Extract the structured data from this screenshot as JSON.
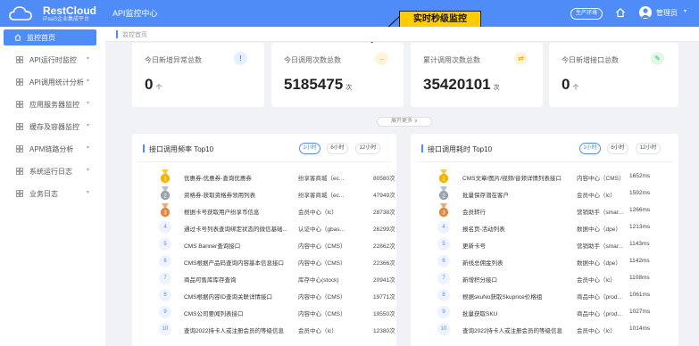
{
  "header": {
    "logo_name": "RestCloud",
    "logo_sub": "iPaaS企业集成平台",
    "app_title": "API监控中心",
    "env_button": "生产环境",
    "user_name": "管理员",
    "user_caret": "▾",
    "brand_color": "#4f8cf7"
  },
  "annotation": {
    "label": "实时秒级监控"
  },
  "sidebar": {
    "items": [
      {
        "label": "监控首页",
        "icon": "home-icon",
        "caret": ""
      },
      {
        "label": "API运行时监控",
        "icon": "grid-icon",
        "caret": "▾"
      },
      {
        "label": "API调用统计分析",
        "icon": "grid-icon",
        "caret": "▾"
      },
      {
        "label": "应用服务器监控",
        "icon": "grid-icon",
        "caret": "▾"
      },
      {
        "label": "缓存及容器监控",
        "icon": "grid-icon",
        "caret": "▾"
      },
      {
        "label": "APM链路分析",
        "icon": "grid-icon",
        "caret": "▾"
      },
      {
        "label": "系统运行日志",
        "icon": "grid-icon",
        "caret": "▾"
      },
      {
        "label": "业务日志",
        "icon": "grid-icon",
        "caret": "▾"
      }
    ]
  },
  "breadcrumb": {
    "current": "监控首页"
  },
  "stats": [
    {
      "title": "今日新增异常总数",
      "value": "0",
      "unit": "个",
      "badge": "!",
      "badge_bg": "#e6efff",
      "badge_color": "#4f8cf7"
    },
    {
      "title": "今日调用次数总数",
      "value": "5185475",
      "unit": "次",
      "badge": "→",
      "badge_bg": "#fff3dc",
      "badge_color": "#f5a623"
    },
    {
      "title": "累计调用次数总数",
      "value": "35420101",
      "unit": "次",
      "badge": "⇄",
      "badge_bg": "#fff3dc",
      "badge_color": "#f5a623"
    },
    {
      "title": "今日新增接口总数",
      "value": "0",
      "unit": "个",
      "badge": "✎",
      "badge_bg": "#e3f7e8",
      "badge_color": "#2eb85c"
    }
  ],
  "expand_more": "展开更多 ∨",
  "panels": [
    {
      "title": "接口调用频率 Top10",
      "tabs": [
        "1小时",
        "6小时",
        "12小时"
      ],
      "active_tab": 0,
      "rows": [
        {
          "rank": "1",
          "name": "优惠券-优惠券-查询优惠券",
          "group": "纷享客商城（ec...",
          "value": "80580次"
        },
        {
          "rank": "2",
          "name": "资格券-获取资格券领用列表",
          "group": "纷享客商城（ec...",
          "value": "47949次"
        },
        {
          "rank": "3",
          "name": "根据卡号获取用户纷享币信息",
          "group": "会员中心（lc）",
          "value": "28738次"
        },
        {
          "rank": "4",
          "name": "通过卡号列表查询绑定状态的微信基础...",
          "group": "认证中心（gbas...",
          "value": "26299次"
        },
        {
          "rank": "5",
          "name": "CMS Banner查询接口",
          "group": "内容中心（CMS）",
          "value": "22862次"
        },
        {
          "rank": "6",
          "name": "CMS根据产品码查询内容基本信息接口",
          "group": "内容中心（CMS）",
          "value": "22366次"
        },
        {
          "rank": "7",
          "name": "商品可售库库存查询",
          "group": "库存中心(stock)",
          "value": "20941次"
        },
        {
          "rank": "8",
          "name": "CMS根据内容ID查询关联详情接口",
          "group": "内容中心（CMS）",
          "value": "19771次"
        },
        {
          "rank": "9",
          "name": "CMS公司要闻列表接口",
          "group": "内容中心（CMS）",
          "value": "19550次"
        },
        {
          "rank": "10",
          "name": "查询2022持卡人或注册会员的等级信息",
          "group": "会员中心（lc）",
          "value": "12380次"
        }
      ]
    },
    {
      "title": "接口调用耗时 Top10",
      "tabs": [
        "1小时",
        "6小时",
        "12小时"
      ],
      "active_tab": 0,
      "rows": [
        {
          "rank": "1",
          "name": "CMS文章/图片/视频/音频详情列表接口",
          "group": "内容中心（CMS）",
          "value": "1652ms"
        },
        {
          "rank": "2",
          "name": "批量保存潜在客户",
          "group": "会员中心（lc）",
          "value": "1592ms"
        },
        {
          "rank": "3",
          "name": "会员转行",
          "group": "营销助手（smar...",
          "value": "1266ms"
        },
        {
          "rank": "4",
          "name": "报名页-活动列表",
          "group": "数据中心（dpe）",
          "value": "1213ms"
        },
        {
          "rank": "5",
          "name": "更新卡号",
          "group": "营销助手（smar...",
          "value": "1143ms"
        },
        {
          "rank": "6",
          "name": "新线总佣金列表",
          "group": "数据中心（dpe）",
          "value": "1142ms"
        },
        {
          "rank": "7",
          "name": "新增积分接口",
          "group": "会员中心（lc）",
          "value": "1108ms"
        },
        {
          "rank": "8",
          "name": "根据skuNo获取Skuprice价格组",
          "group": "商品中心（prod...",
          "value": "1061ms"
        },
        {
          "rank": "9",
          "name": "批量获取SKU",
          "group": "商品中心（prod...",
          "value": "1027ms"
        },
        {
          "rank": "10",
          "name": "查询2022持卡人或注册会员的等级信息",
          "group": "会员中心（lc）",
          "value": "1014ms"
        }
      ]
    }
  ]
}
